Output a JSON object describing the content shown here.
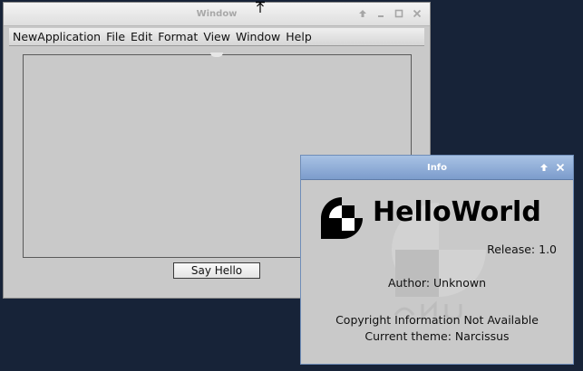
{
  "main_window": {
    "title": "Window",
    "menu": [
      "NewApplication",
      "File",
      "Edit",
      "Format",
      "View",
      "Window",
      "Help"
    ],
    "say_hello_label": "Say Hello"
  },
  "info_window": {
    "title": "Info",
    "app_name": "HelloWorld",
    "release": "Release: 1.0",
    "author": "Author: Unknown",
    "copyright": "Copyright Information Not Available",
    "theme": "Current theme: Narcissus"
  },
  "icons": {
    "titlebar_buttons": [
      "shade-icon",
      "minimize-icon",
      "maximize-icon",
      "close-icon"
    ],
    "info_titlebar_buttons": [
      "shade-icon",
      "close-icon"
    ],
    "app_logo": "gnustep-logo-icon",
    "cursor": "resize-cursor-icon"
  },
  "colors": {
    "desktop": "#172338",
    "window_bg": "#c9c9c9",
    "info_titlebar": "#8aa8d4"
  }
}
